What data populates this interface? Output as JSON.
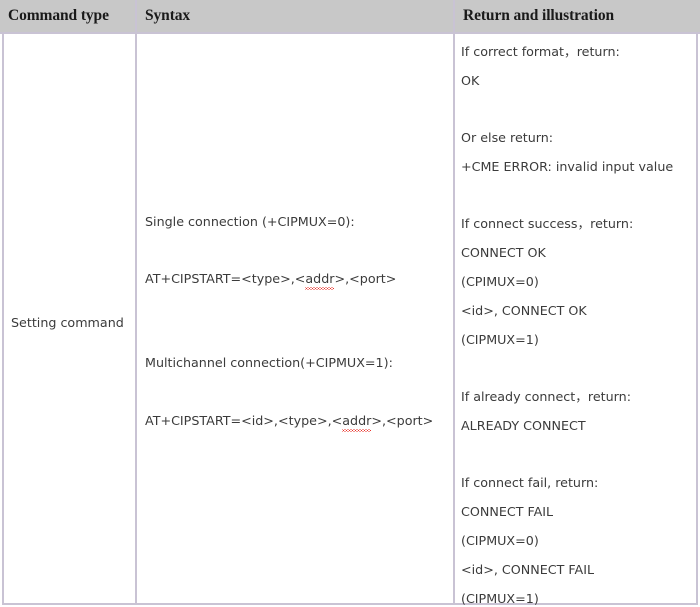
{
  "table": {
    "headers": [
      {
        "label": "Command type",
        "name": "column-header-command-type"
      },
      {
        "label": "Syntax",
        "name": "column-header-syntax"
      },
      {
        "label": "Return and illustration",
        "name": "column-header-return-illustration"
      }
    ],
    "row": {
      "command_type": "Setting command",
      "syntax_lines": [
        "Single connection (+CIPMUX=0):",
        "AT+CIPSTART=<type>,<addr>,<port>",
        "Multichannel connection(+CIPMUX=1):",
        "AT+CIPSTART=<id>,<type>,<addr>,<port>"
      ],
      "syntax_parts": {
        "single_connection_label": "Single connection (+CIPMUX=0):",
        "single_cmd_pre": "AT+CIPSTART=<type>,<",
        "single_cmd_misspelled": "addr",
        "single_cmd_post": ">,<port>",
        "multi_connection_label": "Multichannel connection(+CIPMUX=1):",
        "multi_cmd_pre": "AT+CIPSTART=<id>,<type>,<",
        "multi_cmd_misspelled": "addr",
        "multi_cmd_post": ">,<port>"
      },
      "return_lines": [
        "If correct format，return:",
        "OK",
        "Or else return:",
        "+CME ERROR: invalid input value",
        "If connect success，return:",
        "CONNECT OK",
        "(CPIMUX=0)",
        "<id>, CONNECT OK",
        "(CIPMUX=1)",
        "If already connect，return:",
        "ALREADY CONNECT",
        "If connect fail, return:",
        "CONNECT FAIL",
        "(CIPMUX=0)",
        "<id>, CONNECT FAIL",
        "(CIPMUX=1)"
      ]
    }
  },
  "colors": {
    "header_background": "#c8c8c8",
    "border": "#c9c3d4",
    "text": "#3b3b3b",
    "header_text": "#1a1a1a",
    "spellcheck_underline": "#e8322a",
    "page_background": "#ffffff"
  }
}
